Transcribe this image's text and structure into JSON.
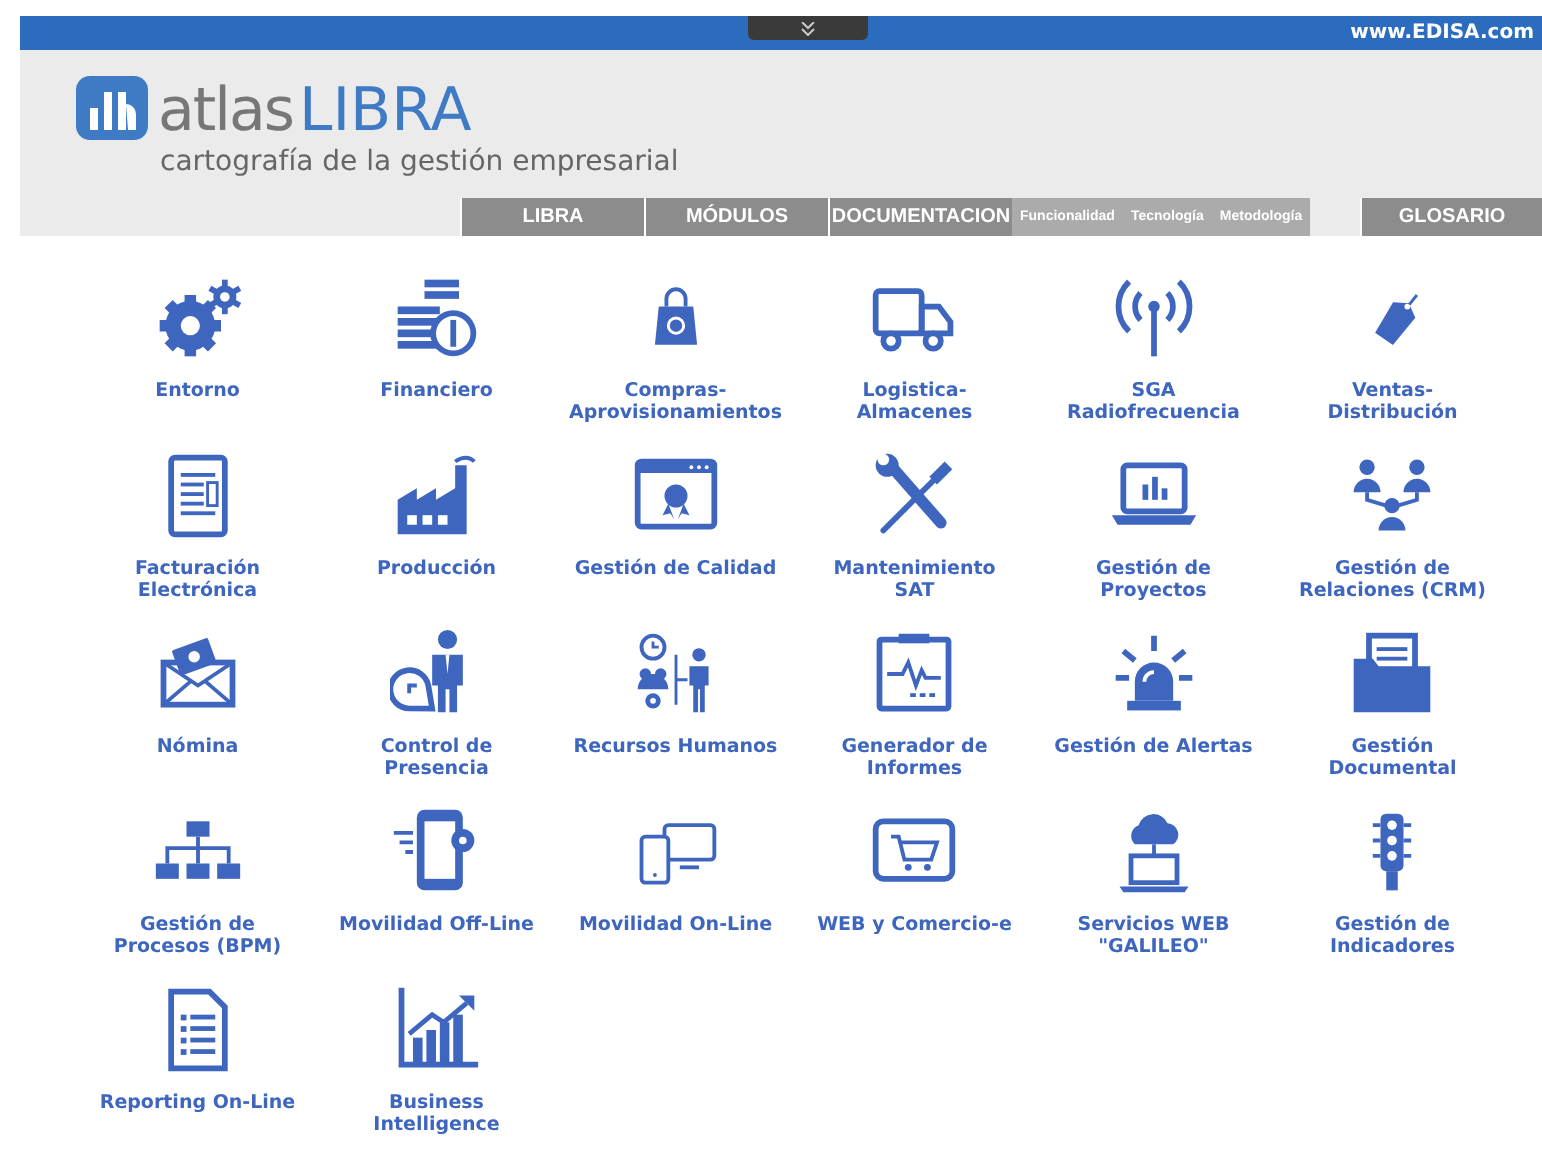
{
  "top_bar": {
    "site": "www.EDISA.com"
  },
  "logo": {
    "brand_light": "atlas",
    "brand_bold": "LIBRA",
    "tagline": "cartografía de la gestión empresarial"
  },
  "nav": [
    {
      "label": "LIBRA",
      "kind": "main"
    },
    {
      "label": "MÓDULOS",
      "kind": "main"
    },
    {
      "label": "DOCUMENTACION",
      "kind": "main"
    },
    {
      "label": "Funcionalidad",
      "kind": "sub"
    },
    {
      "label": "Tecnología",
      "kind": "sub"
    },
    {
      "label": "Metodología",
      "kind": "sub"
    },
    {
      "label": "GLOSARIO",
      "kind": "main"
    }
  ],
  "modules": [
    {
      "label": "Entorno"
    },
    {
      "label": "Financiero"
    },
    {
      "label": "Compras-\nAprovisionamientos"
    },
    {
      "label": "Logistica-\nAlmacenes"
    },
    {
      "label": "SGA\nRadiofrecuencia"
    },
    {
      "label": "Ventas-\nDistribución"
    },
    {
      "label": "Facturación\nElectrónica"
    },
    {
      "label": "Producción"
    },
    {
      "label": "Gestión de Calidad"
    },
    {
      "label": "Mantenimiento\nSAT"
    },
    {
      "label": "Gestión de\nProyectos"
    },
    {
      "label": "Gestión de\nRelaciones (CRM)"
    },
    {
      "label": "Nómina"
    },
    {
      "label": "Control de\nPresencia"
    },
    {
      "label": "Recursos Humanos"
    },
    {
      "label": "Generador de\nInformes"
    },
    {
      "label": "Gestión de Alertas"
    },
    {
      "label": "Gestión\nDocumental"
    },
    {
      "label": "Gestión de\nProcesos (BPM)"
    },
    {
      "label": "Movilidad Off-Line"
    },
    {
      "label": "Movilidad On-Line"
    },
    {
      "label": "WEB y Comercio-e"
    },
    {
      "label": "Servicios WEB\n\"GALILEO\""
    },
    {
      "label": "Gestión de\nIndicadores"
    },
    {
      "label": "Reporting On-Line"
    },
    {
      "label": "Business\nIntelligence"
    }
  ]
}
